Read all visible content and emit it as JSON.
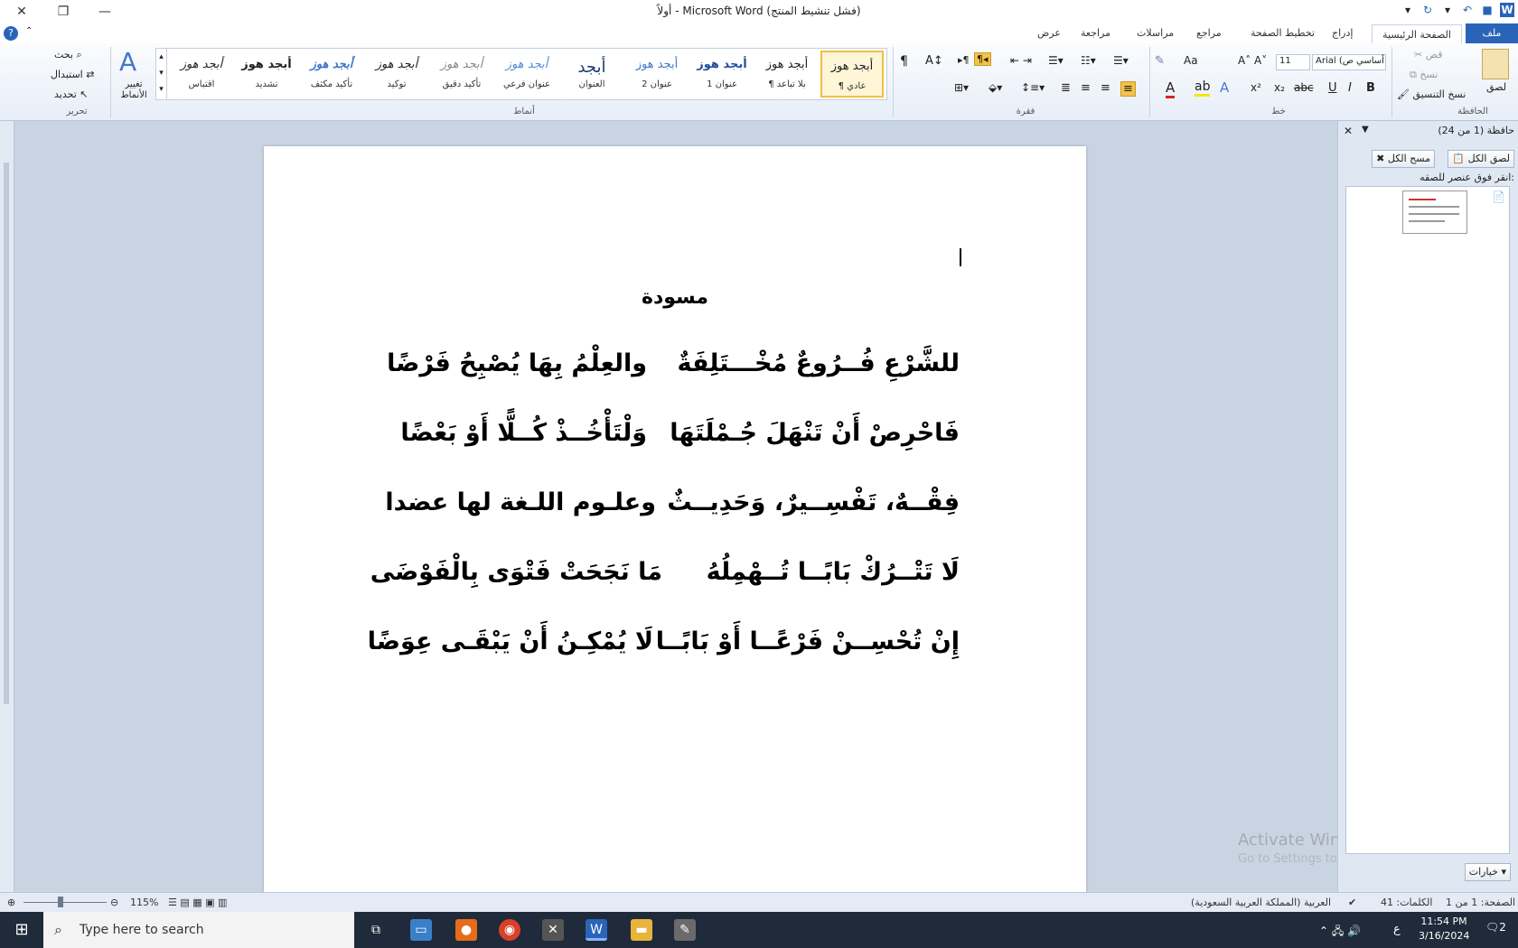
{
  "window": {
    "title": "أولاً  -  Microsoft Word (فشل تنشيط المنتج)"
  },
  "tabs": [
    "ملف",
    "الصفحة الرئيسية",
    "إدراج",
    "تخطيط الصفحة",
    "مراجع",
    "مراسلات",
    "مراجعة",
    "عرض"
  ],
  "ribbon": {
    "clipboard": {
      "label": "الحافظة",
      "paste": "لصق",
      "cut": "قص",
      "copy": "نسخ",
      "format_painter": "نسخ التنسيق"
    },
    "font": {
      "label": "خط",
      "font_name": "Arial (أساسي ص",
      "font_size": "11"
    },
    "paragraph": {
      "label": "فقرة"
    },
    "styles": {
      "label": "أنماط",
      "change_styles": "تغيير الأنماط",
      "items": [
        {
          "sample": "أبجد هوز",
          "name": "¶ عادي"
        },
        {
          "sample": "أبجد هوز",
          "name": "¶ بلا تباعد"
        },
        {
          "sample": "أبجد هوز",
          "name": "عنوان 1"
        },
        {
          "sample": "أبجد هوز",
          "name": "عنوان 2"
        },
        {
          "sample": "أبجد",
          "name": "العنوان"
        },
        {
          "sample": "أبجد هوز",
          "name": "عنوان فرعي"
        },
        {
          "sample": "أبجد هوز",
          "name": "تأكيد دقيق"
        },
        {
          "sample": "أبجد هوز",
          "name": "توكيد"
        },
        {
          "sample": "أبجد هوز",
          "name": "تأكيد مكثف"
        },
        {
          "sample": "أبجد هوز",
          "name": "تشديد"
        },
        {
          "sample": "أبجد هوز",
          "name": "اقتباس"
        }
      ]
    },
    "editing": {
      "label": "تحرير",
      "find": "بحث",
      "replace": "استبدال",
      "select": "تحديد"
    }
  },
  "document": {
    "title": "مسودة",
    "verses": [
      {
        "right": "للشَّرْعِ فُــرُوعٌ مُخْـــتَلِفَةٌ",
        "left": "والعِلْمُ بِهَا يُصْبِحُ فَرْضًا"
      },
      {
        "right": "فَاحْرِصْ أَنْ تَنْهَلَ جُـمْلَتَهَا",
        "left": "وَلْتَأْخُــذْ كُــلًّا أَوْ بَعْضًا"
      },
      {
        "right": "فِقْــهٌ، تَفْسِــيرٌ، وَحَدِيــثٌ",
        "left": "وعلـوم اللـغة لها عضدا"
      },
      {
        "right": "لَا تَتْــرُكْ بَابًــا تُــهْمِلُهُ",
        "left": "مَا نَجَحَتْ فَتْوَى بِالْفَوْضَى"
      },
      {
        "right": "إِنْ تُحْسِــنْ فَرْعًــا أَوْ بَابًــا",
        "left": "لَا يُمْكِـنُ أَنْ يَبْقَـى عِوَضًا"
      }
    ]
  },
  "clipboard_pane": {
    "title": "حافظة (1 من 24)",
    "paste_all": "لصق الكل",
    "clear_all": "مسح الكل",
    "hint": "انقر فوق عنصر للصقه:",
    "options": "خيارات"
  },
  "watermark": {
    "line1": "Activate Windows",
    "line2": "Go to Settings to activate Windows."
  },
  "statusbar": {
    "page": "الصفحة: 1 من 1",
    "words": "الكلمات: 41",
    "language": "العربية (المملكة العربية السعودية)",
    "zoom": "115%"
  },
  "taskbar": {
    "search_placeholder": "Type here to search",
    "time": "11:54 PM",
    "date": "3/16/2024",
    "lang": "ع",
    "notifications": "2"
  }
}
